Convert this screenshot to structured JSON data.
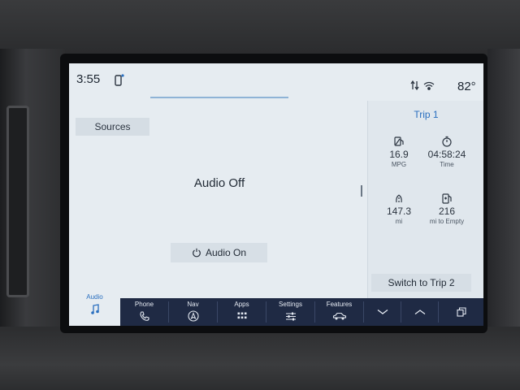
{
  "status_bar": {
    "time": "3:55",
    "temperature": "82°",
    "icons": [
      "phone-connected-icon",
      "data-transfer-icon",
      "wifi-icon"
    ]
  },
  "main": {
    "sources_label": "Sources",
    "audio_state": "Audio Off",
    "audio_on_label": "Audio On"
  },
  "trip": {
    "title": "Trip 1",
    "metrics": [
      {
        "icon": "fuel-economy-icon",
        "value": "16.9",
        "label": "MPG"
      },
      {
        "icon": "stopwatch-icon",
        "value": "04:58:24",
        "label": "Time"
      },
      {
        "icon": "road-distance-icon",
        "value": "147.3",
        "label": "mi"
      },
      {
        "icon": "fuel-pump-icon",
        "value": "216",
        "label": "mi to Empty"
      }
    ],
    "switch_label": "Switch to Trip 2"
  },
  "nav": {
    "items": [
      {
        "label": "Audio",
        "icon": "music-note-icon",
        "active": true
      },
      {
        "label": "Phone",
        "icon": "phone-icon"
      },
      {
        "label": "Nav",
        "icon": "compass-icon"
      },
      {
        "label": "Apps",
        "icon": "apps-grid-icon"
      },
      {
        "label": "Settings",
        "icon": "sliders-icon"
      },
      {
        "label": "Features",
        "icon": "car-icon"
      }
    ],
    "controls": [
      "chevron-down-icon",
      "chevron-up-icon",
      "copy-icon"
    ]
  },
  "colors": {
    "screen_bg": "#e6ecf1",
    "nav_bg": "#1f2a44",
    "accent": "#2a6fbf"
  }
}
